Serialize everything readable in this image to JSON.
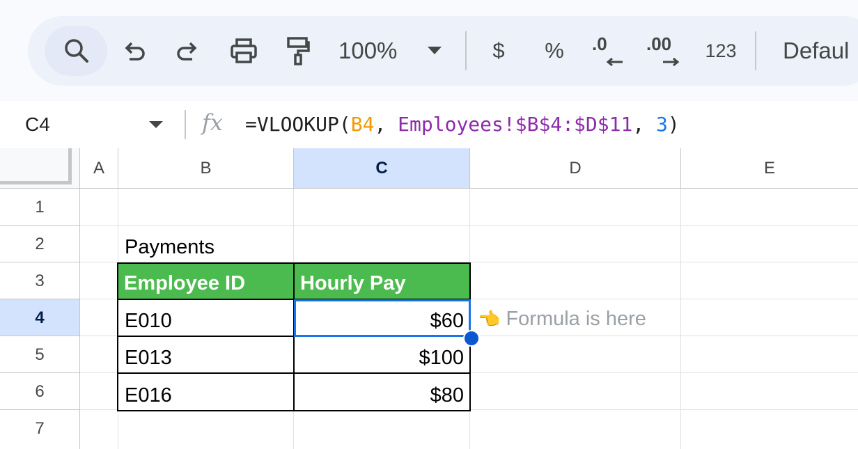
{
  "toolbar": {
    "zoom": "100%",
    "currency": "$",
    "percent": "%",
    "decrease_decimal": ".0",
    "increase_decimal": ".00",
    "number_format": "123",
    "font": "Defaul"
  },
  "formula_bar": {
    "name_box": "C4",
    "fx": "fx",
    "formula_parts": {
      "p1": "=VLOOKUP(",
      "p2": "B4",
      "p3": ", ",
      "p4": "Employees!$B$4:$D$11",
      "p5": ", ",
      "p6": "3",
      "p7": ")"
    },
    "colors": {
      "ref": "#f29900",
      "range": "#8e2ba9",
      "number": "#1a73e8"
    }
  },
  "columns": [
    "A",
    "B",
    "C",
    "D",
    "E"
  ],
  "rows": [
    "1",
    "2",
    "3",
    "4",
    "5",
    "6",
    "7"
  ],
  "sheet": {
    "title": "Payments",
    "headers": {
      "b": "Employee ID",
      "c": "Hourly Pay"
    },
    "data": [
      {
        "id": "E010",
        "pay": "$60"
      },
      {
        "id": "E013",
        "pay": "$100"
      },
      {
        "id": "E016",
        "pay": "$80"
      }
    ],
    "note_icon": "👈",
    "note": "Formula is here"
  },
  "colors": {
    "header_fill": "#4cbb4f",
    "selection": "#1a73e8"
  }
}
